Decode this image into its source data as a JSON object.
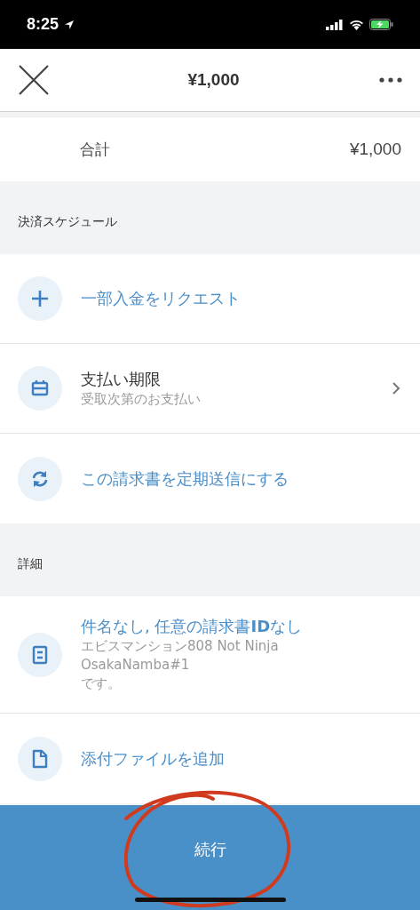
{
  "status_bar": {
    "time": "8:25"
  },
  "nav": {
    "title": "¥1,000"
  },
  "total": {
    "label": "合計",
    "amount": "¥1,000"
  },
  "sections": [
    {
      "header": "決済スケジュール",
      "rows": [
        {
          "kind": "action",
          "title": "一部入金をリクエスト"
        },
        {
          "kind": "link",
          "title": "支払い期限",
          "lines": [
            "受取次第のお支払い"
          ]
        },
        {
          "kind": "action",
          "title": "この請求書を定期送信にする"
        }
      ]
    },
    {
      "header": "詳細",
      "rows": [
        {
          "kind": "action",
          "title": "件名なし, 任意の請求書**ID**なし",
          "lines": [
            "エビスマンション808 Not Ninja",
            "OsakaNamba#1",
            "です。"
          ]
        },
        {
          "kind": "action",
          "title": "添付ファイルを追加"
        }
      ]
    }
  ],
  "primary_button": {
    "label": "続行"
  }
}
